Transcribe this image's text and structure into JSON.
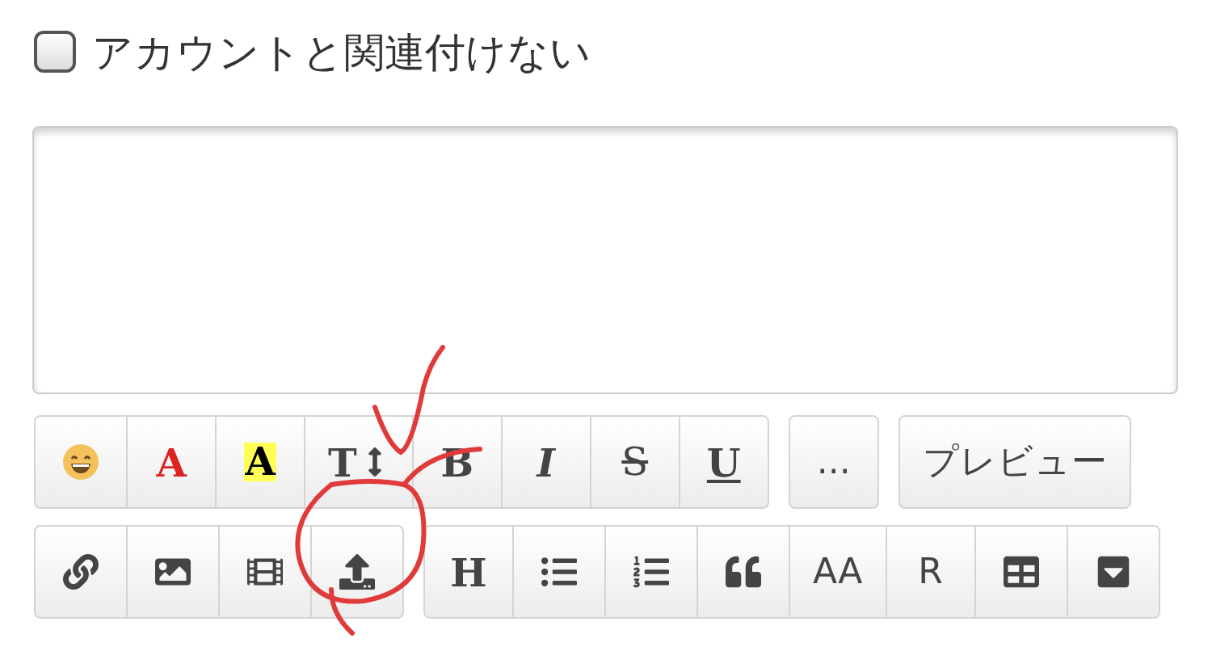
{
  "checkbox": {
    "label": "アカウントと関連付けない",
    "checked": false
  },
  "toolbar_rows": [
    [
      {
        "buttons": [
          {
            "kind": "icon"
          },
          {
            "kind": "red",
            "label": "A"
          },
          {
            "kind": "highlight",
            "label": "A"
          },
          {
            "kind": "size",
            "label": "T"
          },
          {
            "kind": "bold",
            "label": "B"
          },
          {
            "kind": "italic",
            "label": "I"
          },
          {
            "kind": "strike",
            "label": "S"
          },
          {
            "kind": "underline",
            "label": "U"
          }
        ]
      },
      {
        "buttons": [
          {
            "kind": "plain",
            "label": "..."
          }
        ]
      },
      {
        "buttons": [
          {
            "kind": "plain",
            "label": "プレビュー"
          }
        ]
      }
    ],
    [
      {
        "buttons": [
          {
            "kind": "icon"
          },
          {
            "kind": "icon"
          },
          {
            "kind": "icon"
          },
          {
            "kind": "icon"
          }
        ]
      },
      {
        "buttons": [
          {
            "kind": "serif",
            "label": "H"
          },
          {
            "kind": "icon"
          },
          {
            "kind": "icon"
          },
          {
            "kind": "icon"
          },
          {
            "kind": "plain",
            "label": "AA"
          },
          {
            "kind": "plain",
            "label": "R"
          },
          {
            "kind": "icon"
          },
          {
            "kind": "icon"
          }
        ]
      }
    ]
  ]
}
